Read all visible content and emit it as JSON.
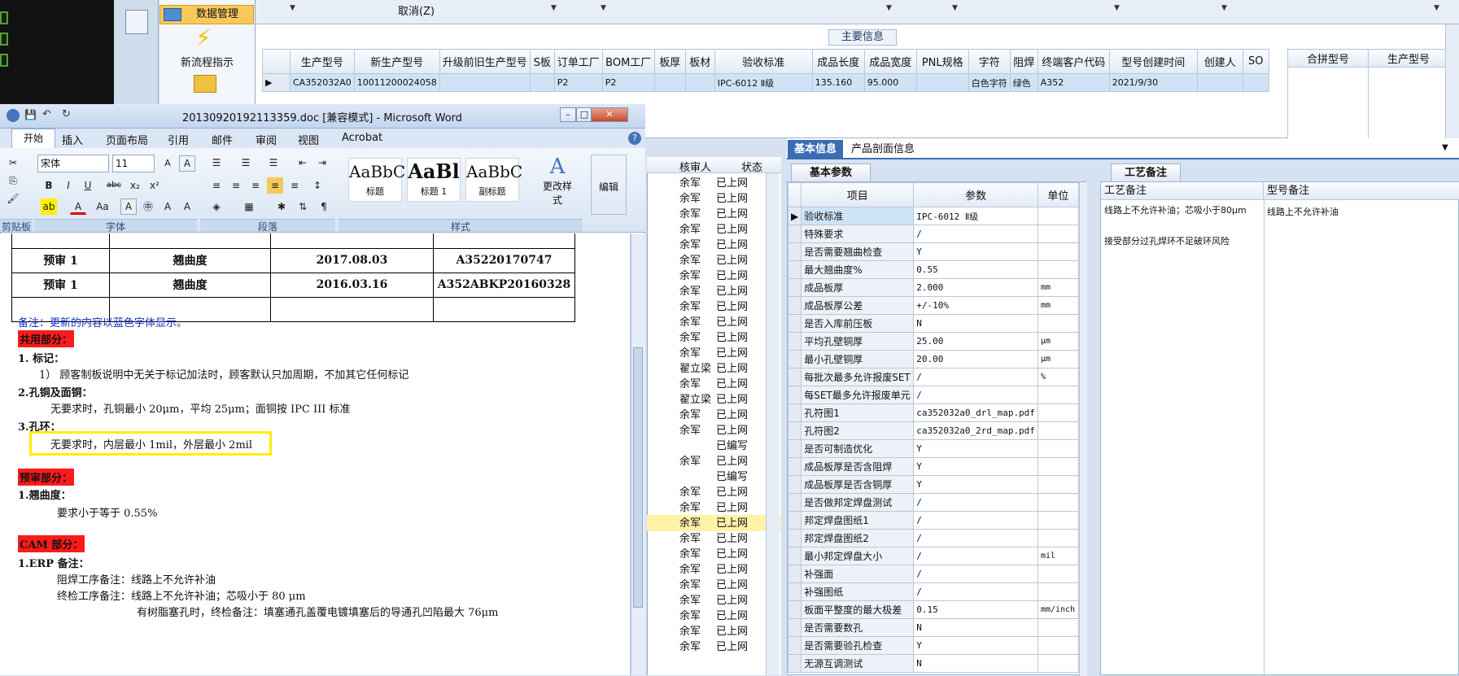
{
  "app": {
    "data_mgmt_label": "数据管理",
    "new_flow_label": "新流程指示",
    "cancel_label": "取消(Z)"
  },
  "main_info": {
    "title": "主要信息",
    "columns": [
      "生产型号",
      "新生产型号",
      "升级前旧生产型号",
      "S板",
      "订单工厂",
      "BOM工厂",
      "板厚",
      "板材",
      "验收标准",
      "成品长度",
      "成品宽度",
      "PNL规格",
      "字符",
      "阻焊",
      "终端客户代码",
      "型号创建时间",
      "创建人",
      "SO"
    ],
    "row": [
      "CA352032A0",
      "10011200024058",
      "",
      "",
      "P2",
      "P2",
      "",
      "",
      "IPC-6012 Ⅱ级",
      "135.160",
      "95.000",
      "",
      "白色字符",
      "绿色",
      "A352",
      "2021/9/30",
      "",
      ""
    ],
    "merge_columns": [
      "合拼型号",
      "生产型号"
    ]
  },
  "reviewer_list": {
    "columns": [
      "核审人",
      "状态"
    ],
    "rows": [
      [
        "余军",
        "已上网"
      ],
      [
        "余军",
        "已上网"
      ],
      [
        "余军",
        "已上网"
      ],
      [
        "余军",
        "已上网"
      ],
      [
        "余军",
        "已上网"
      ],
      [
        "余军",
        "已上网"
      ],
      [
        "余军",
        "已上网"
      ],
      [
        "余军",
        "已上网"
      ],
      [
        "余军",
        "已上网"
      ],
      [
        "余军",
        "已上网"
      ],
      [
        "余军",
        "已上网"
      ],
      [
        "余军",
        "已上网"
      ],
      [
        "翟立梁",
        "已上网"
      ],
      [
        "余军",
        "已上网"
      ],
      [
        "翟立梁",
        "已上网"
      ],
      [
        "余军",
        "已上网"
      ],
      [
        "余军",
        "已上网"
      ],
      [
        "",
        "已编写"
      ],
      [
        "余军",
        "已上网"
      ],
      [
        "",
        "已编写"
      ],
      [
        "余军",
        "已上网"
      ],
      [
        "余军",
        "已上网"
      ],
      [
        "余军",
        "已上网"
      ],
      [
        "余军",
        "已上网"
      ],
      [
        "余军",
        "已上网"
      ],
      [
        "余军",
        "已上网"
      ],
      [
        "余军",
        "已上网"
      ],
      [
        "余军",
        "已上网"
      ],
      [
        "余军",
        "已上网"
      ],
      [
        "余军",
        "已上网"
      ],
      [
        "余军",
        "已上网"
      ]
    ]
  },
  "tabs": {
    "basic": "基本信息",
    "profile": "产品剖面信息"
  },
  "basic_params": {
    "title": "基本参数",
    "columns": [
      "项目",
      "参数",
      "单位"
    ],
    "rows": [
      [
        "验收标准",
        "IPC-6012 Ⅱ级",
        ""
      ],
      [
        "特殊要求",
        "/",
        ""
      ],
      [
        "是否需要翘曲检查",
        "Y",
        ""
      ],
      [
        "最大翘曲度%",
        "0.55",
        ""
      ],
      [
        "成品板厚",
        "2.000",
        "mm"
      ],
      [
        "成品板厚公差",
        "+/-10%",
        "mm"
      ],
      [
        "是否入库前压板",
        "N",
        ""
      ],
      [
        "平均孔壁铜厚",
        "25.00",
        "μm"
      ],
      [
        "最小孔壁铜厚",
        "20.00",
        "μm"
      ],
      [
        "每批次最多允许报废SET",
        "/",
        "%"
      ],
      [
        "每SET最多允许报废单元",
        "/",
        ""
      ],
      [
        "孔符图1",
        "ca352032a0_drl_map.pdf",
        ""
      ],
      [
        "孔符图2",
        "ca352032a0_2rd_map.pdf",
        ""
      ],
      [
        "是否可制造优化",
        "Y",
        ""
      ],
      [
        "成品板厚是否含阻焊",
        "Y",
        ""
      ],
      [
        "成品板厚是否含铜厚",
        "Y",
        ""
      ],
      [
        "是否做邦定焊盘测试",
        "/",
        ""
      ],
      [
        "邦定焊盘图纸1",
        "/",
        ""
      ],
      [
        "邦定焊盘图纸2",
        "/",
        ""
      ],
      [
        "最小邦定焊盘大小",
        "/",
        "mil"
      ],
      [
        "补强面",
        "/",
        ""
      ],
      [
        "补强图纸",
        "/",
        ""
      ],
      [
        "板面平整度的最大极差",
        "0.15",
        "mm/inch"
      ],
      [
        "是否需要数孔",
        "N",
        ""
      ],
      [
        "是否需要验孔检查",
        "Y",
        ""
      ],
      [
        "无源互调测试",
        "N",
        ""
      ]
    ]
  },
  "craft_notes": {
    "title": "工艺备注",
    "col1": "工艺备注",
    "col2": "型号备注",
    "note1": "线路上不允许补油；芯吸小于80μm",
    "note2": "接受部分过孔焊环不足破环风险",
    "model_note": "线路上不允许补油"
  },
  "word": {
    "title": "20130920192113359.doc [兼容模式] - Microsoft Word",
    "tabs": [
      "开始",
      "插入",
      "页面布局",
      "引用",
      "邮件",
      "审阅",
      "视图",
      "Acrobat"
    ],
    "font_name": "宋体",
    "font_size": "11",
    "groups": {
      "clipboard": "剪贴板",
      "font": "字体",
      "paragraph": "段落",
      "styles": "样式"
    },
    "styles": [
      {
        "sample": "AaBbC",
        "name": "标题"
      },
      {
        "sample": "AaBl",
        "name": "标题 1"
      },
      {
        "sample": "AaBbC",
        "name": "副标题"
      }
    ],
    "change_styles": "更改样式",
    "edit": "编辑",
    "table_rows": [
      [
        "预审 1",
        "翘曲度",
        "2017.08.03",
        "A35220170747"
      ],
      [
        "预审 1",
        "翘曲度",
        "2016.03.16",
        "A352ABKP20160328"
      ]
    ],
    "doc": {
      "note": "备注：更新的内容以蓝色字体显示。",
      "shared_heading": "共用部分：",
      "s1_title": "1.  标记：",
      "s1_text": "1） 顾客制板说明中无关于标记加法时，顾客默认只加周期，不加其它任何标记",
      "s2_title": "2.孔铜及面铜：",
      "s2_text": "无要求时，孔铜最小 20μm，平均 25μm；面铜按 IPC III 标准",
      "s3_title": "3.孔环：",
      "s3_text": "无要求时，内层最小 1mil，外层最小 2mil",
      "pre_heading": "预审部分：",
      "p1_title": "1.翘曲度：",
      "p1_text": "要求小于等于 0.55%",
      "cam_heading": "CAM 部分：",
      "c1_title": "1.ERP 备注：",
      "c1_l1": "阻焊工序备注：线路上不允许补油",
      "c1_l2": "终检工序备注：线路上不允许补油；芯吸小于 80 μm",
      "c1_l3": "有树脂塞孔时，终检备注：填塞通孔盖覆电镀填塞后的导通孔凹陷最大 76μm"
    }
  }
}
